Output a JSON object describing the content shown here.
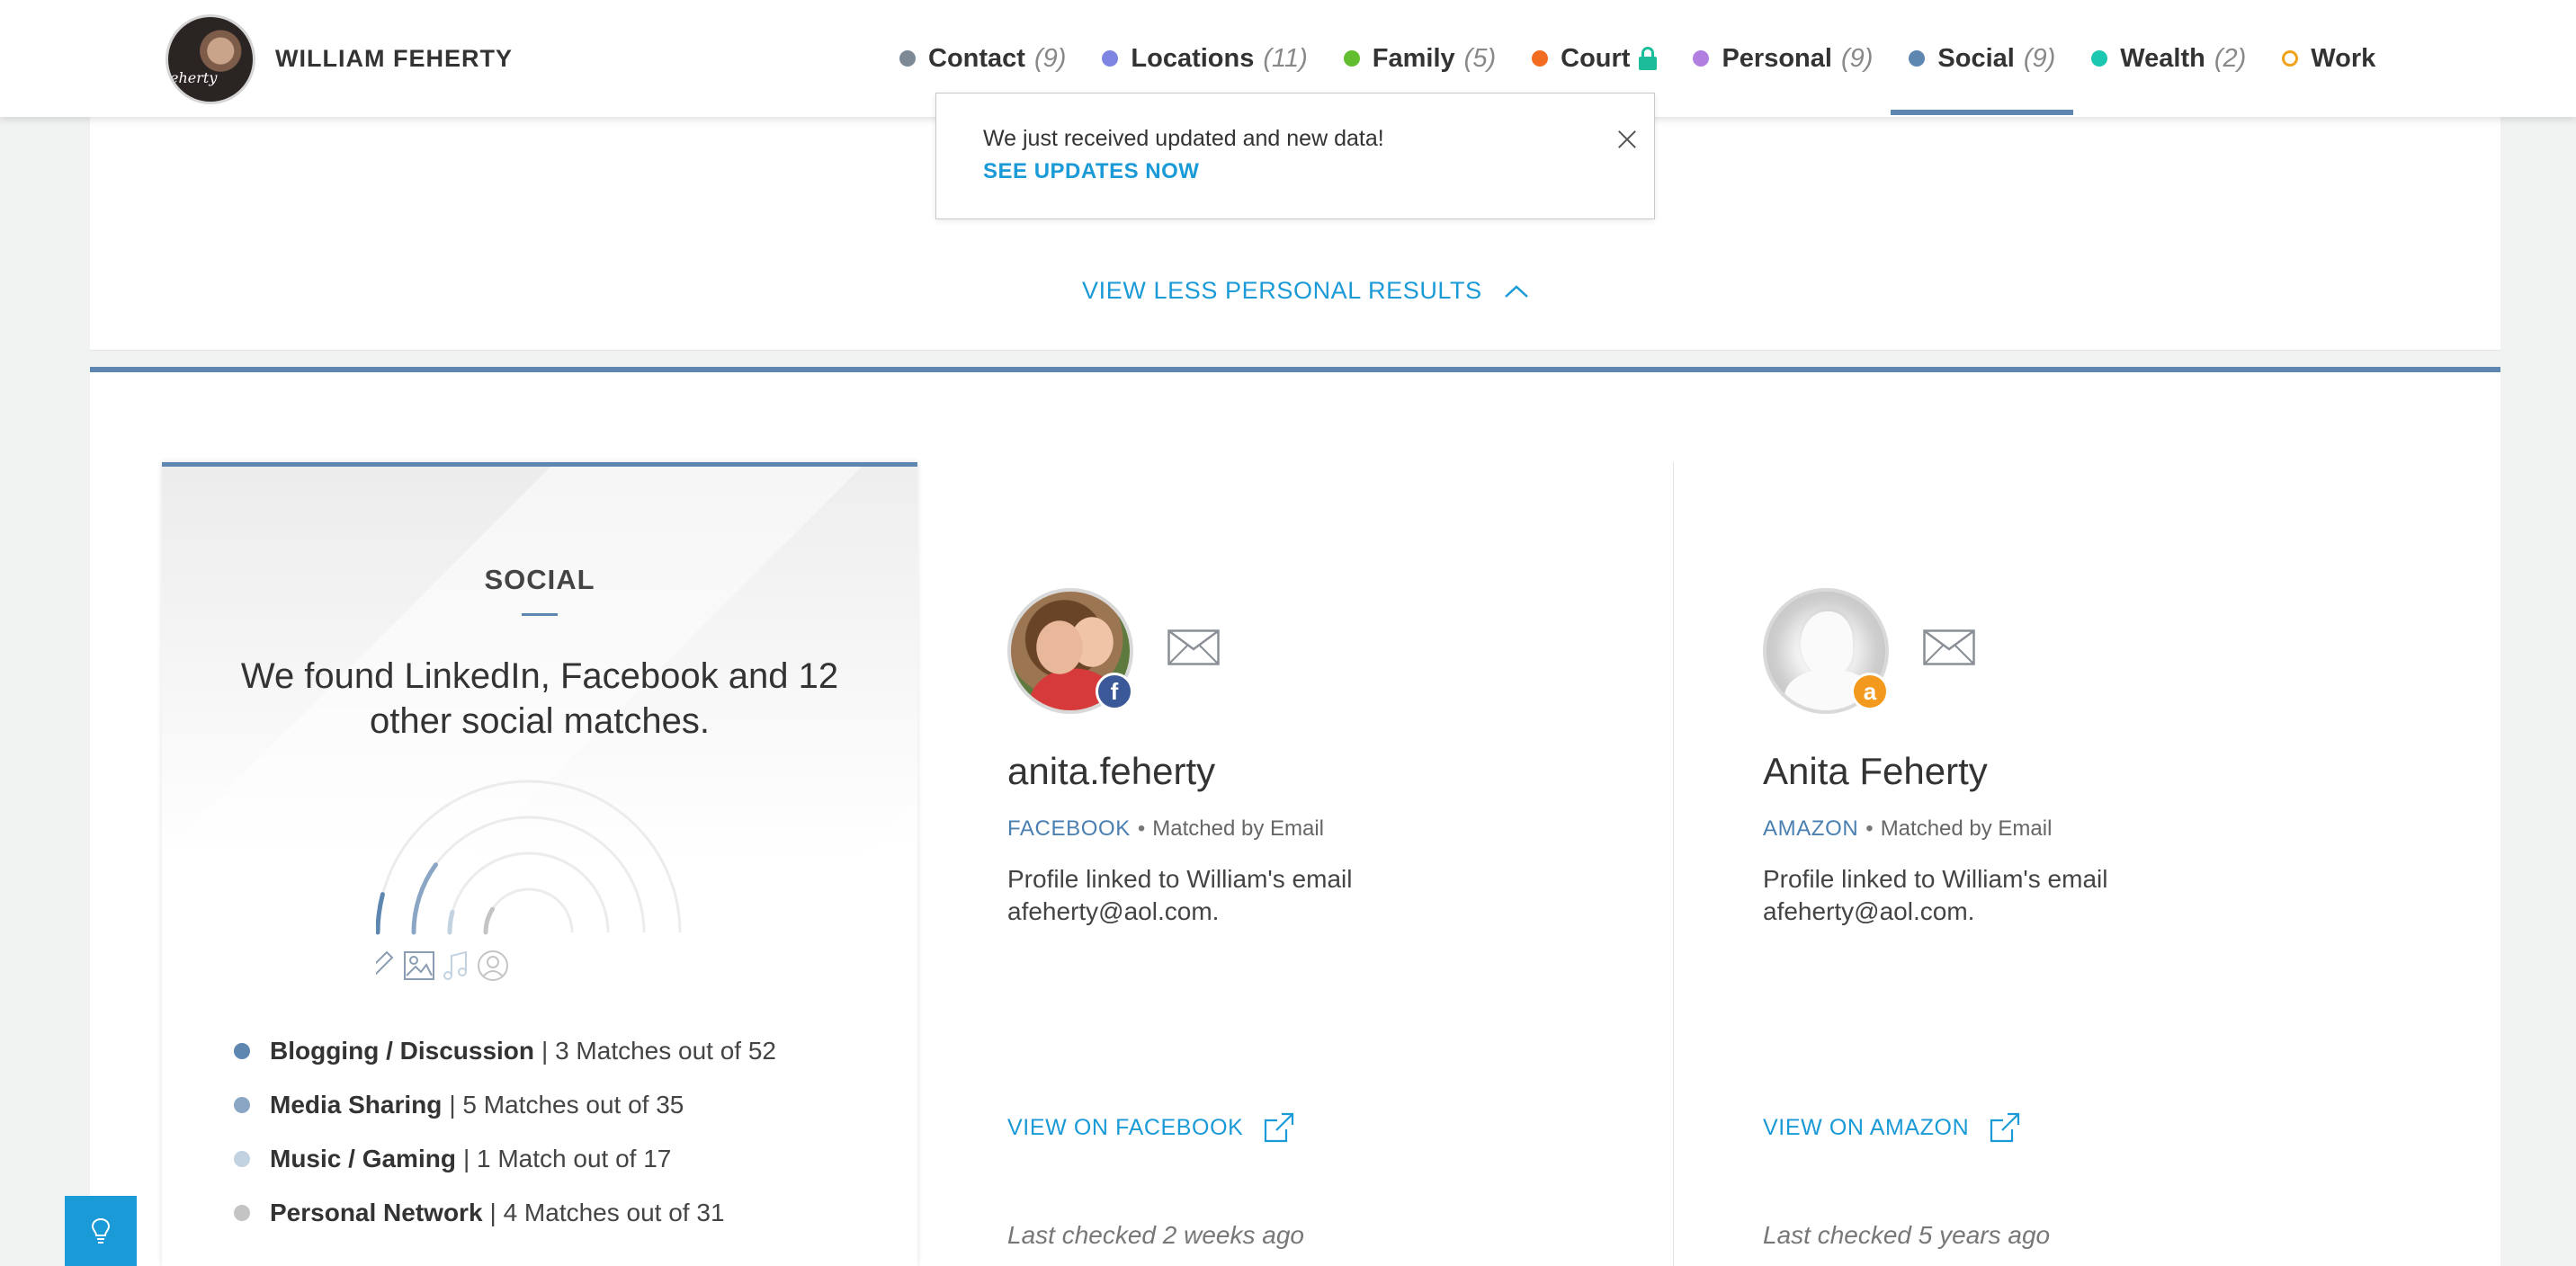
{
  "header": {
    "name": "WILLIAM FEHERTY",
    "avatar_signature": "eherty"
  },
  "nav": [
    {
      "label": "Contact",
      "count": "(9)",
      "color": "#7d8a96",
      "dot": "filled",
      "icon": ""
    },
    {
      "label": "Locations",
      "count": "(11)",
      "color": "#7e85e0",
      "dot": "filled",
      "icon": ""
    },
    {
      "label": "Family",
      "count": "(5)",
      "color": "#62be2f",
      "dot": "filled",
      "icon": ""
    },
    {
      "label": "Court",
      "count": "",
      "color": "#f26d21",
      "dot": "filled",
      "icon": "lock-icon"
    },
    {
      "label": "Personal",
      "count": "(9)",
      "color": "#b07fe0",
      "dot": "filled",
      "icon": ""
    },
    {
      "label": "Social",
      "count": "(9)",
      "color": "#5d86b0",
      "dot": "filled",
      "icon": "",
      "active": true
    },
    {
      "label": "Wealth",
      "count": "(2)",
      "color": "#1cc7b1",
      "dot": "filled",
      "icon": ""
    },
    {
      "label": "Work",
      "count": "",
      "color": "#f0a21a",
      "dot": "hollow",
      "icon": ""
    }
  ],
  "toast": {
    "message": "We just received updated and new data!",
    "link": "SEE UPDATES NOW",
    "close_icon": "close-icon"
  },
  "personal": {
    "view_less": "VIEW LESS PERSONAL RESULTS",
    "icon": "chevron-up-icon"
  },
  "social": {
    "title": "SOCIAL",
    "summary": "We found LinkedIn, Facebook and 12 other social matches.",
    "category_icons": [
      "pencil-icon",
      "image-icon",
      "music-icon",
      "person-icon"
    ],
    "categories": [
      {
        "name": "Blogging / Discussion",
        "matches": "| 3 Matches out of 52",
        "color": "#5d86b0",
        "fraction": 0.058
      },
      {
        "name": "Media Sharing",
        "matches": "| 5 Matches out of 35",
        "color": "#8aa6c4",
        "fraction": 0.143
      },
      {
        "name": "Music / Gaming",
        "matches": "| 1 Match out of 17",
        "color": "#c3d2e1",
        "fraction": 0.059
      },
      {
        "name": "Personal Network",
        "matches": "| 4 Matches out of 31",
        "color": "#c4c4c4",
        "fraction": 0.129
      }
    ],
    "matches": [
      {
        "name": "anita.feherty",
        "source": "FACEBOOK",
        "matched_by": "Matched by Email",
        "description": "Profile linked to William's email afeherty@aol.com.",
        "link": "VIEW ON FACEBOOK",
        "checked": "Last checked 2 weeks ago",
        "badge": "f",
        "badge_color": "#3b5998"
      },
      {
        "name": "Anita Feherty",
        "source": "AMAZON",
        "matched_by": "Matched by Email",
        "description": "Profile linked to William's email afeherty@aol.com.",
        "link": "VIEW ON AMAZON",
        "checked": "Last checked 5 years ago",
        "badge": "a",
        "badge_color": "#f39a1e"
      }
    ]
  },
  "help": {
    "icon": "lightbulb-icon"
  }
}
